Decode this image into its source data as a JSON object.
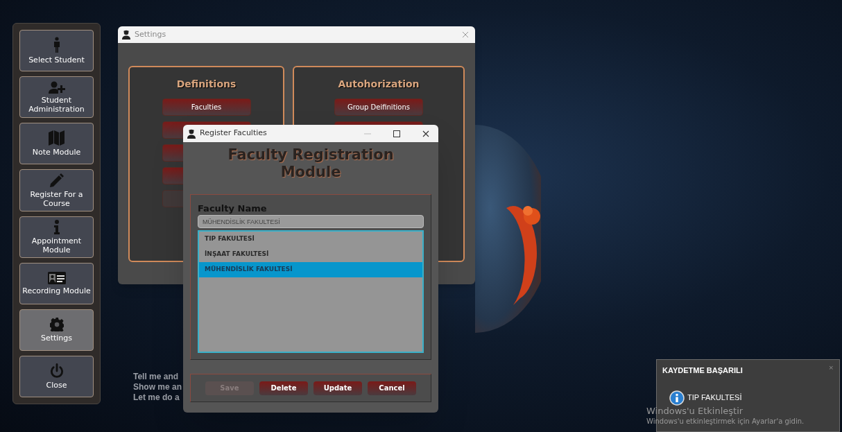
{
  "sidebar": {
    "items": [
      {
        "label": "Select Student",
        "kind": "person",
        "selected": false
      },
      {
        "label": "Student Administration",
        "kind": "userplus",
        "selected": false
      },
      {
        "label": "Note Module",
        "kind": "map",
        "selected": false
      },
      {
        "label": "Register For a Course",
        "kind": "pencil",
        "selected": false
      },
      {
        "label": "Appointment Module",
        "kind": "info",
        "selected": false
      },
      {
        "label": "Recording Module",
        "kind": "card",
        "selected": false
      },
      {
        "label": "Settings",
        "kind": "gear",
        "selected": true
      },
      {
        "label": "Close",
        "kind": "power",
        "selected": false
      }
    ]
  },
  "motto": [
    "Tell me and",
    "Show me an",
    "Let me do a"
  ],
  "settings_window": {
    "title": "Settings",
    "panels": [
      {
        "title": "Definitions",
        "buttons": [
          {
            "label": "Faculties",
            "disabled": false
          },
          {
            "disabled": false
          },
          {
            "disabled": false
          },
          {
            "disabled": false
          },
          {
            "disabled": true
          }
        ]
      },
      {
        "title": "Autohorization",
        "buttons": [
          {
            "label": "Group Deifinitions",
            "disabled": false
          },
          {
            "disabled": false
          }
        ]
      }
    ]
  },
  "register_window": {
    "title": "Register Faculties",
    "heading": "Faculty Registration Module",
    "field_label": "Faculty Name",
    "field_value": "MÜHENDİSLİK FAKULTESİ",
    "list": [
      {
        "label": "TIP FAKULTESİ",
        "selected": false
      },
      {
        "label": "İNŞAAT FAKULTESİ",
        "selected": false
      },
      {
        "label": "MÜHENDİSLİK FAKULTESİ",
        "selected": true
      }
    ],
    "buttons": [
      {
        "label": "Save",
        "disabled": true
      },
      {
        "label": "Delete",
        "disabled": false
      },
      {
        "label": "Update",
        "disabled": false
      },
      {
        "label": "Cancel",
        "disabled": false
      }
    ]
  },
  "notification": {
    "title": "KAYDETME BAŞARILI",
    "close": "×",
    "message": "TIP FAKULTESİ"
  },
  "activation_notice": {
    "title": "Windows'u Etkinleştir",
    "message": "Windows'u etkinleştirmek için Ayarlar'a gidin."
  }
}
